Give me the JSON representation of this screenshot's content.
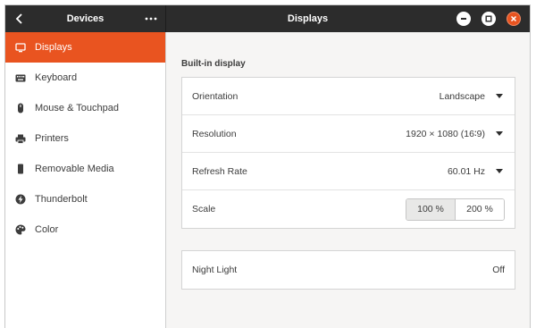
{
  "titlebar": {
    "sidebar_title": "Devices",
    "main_title": "Displays"
  },
  "sidebar": {
    "items": [
      {
        "label": "Displays",
        "icon": "monitor-icon",
        "active": true
      },
      {
        "label": "Keyboard",
        "icon": "keyboard-icon",
        "active": false
      },
      {
        "label": "Mouse & Touchpad",
        "icon": "mouse-icon",
        "active": false
      },
      {
        "label": "Printers",
        "icon": "printer-icon",
        "active": false
      },
      {
        "label": "Removable Media",
        "icon": "removable-media-icon",
        "active": false
      },
      {
        "label": "Thunderbolt",
        "icon": "thunderbolt-icon",
        "active": false
      },
      {
        "label": "Color",
        "icon": "palette-icon",
        "active": false
      }
    ]
  },
  "main": {
    "section_title": "Built-in display",
    "display_settings": [
      {
        "label": "Orientation",
        "value": "Landscape"
      },
      {
        "label": "Resolution",
        "value": "1920 × 1080 (16∶9)"
      },
      {
        "label": "Refresh Rate",
        "value": "60.01 Hz"
      }
    ],
    "scale": {
      "label": "Scale",
      "options": [
        "100 %",
        "200 %"
      ],
      "selected": "100 %"
    },
    "night_light": {
      "label": "Night Light",
      "value": "Off"
    }
  },
  "colors": {
    "accent": "#e95420",
    "titlebar": "#2c2c2c"
  }
}
